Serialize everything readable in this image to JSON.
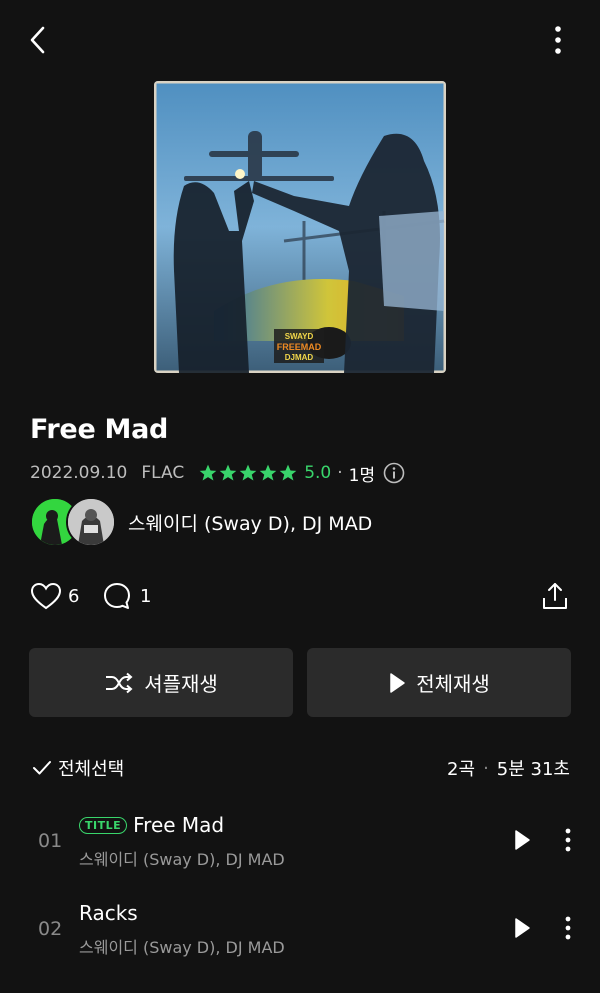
{
  "album": {
    "title": "Free Mad",
    "release_date": "2022.09.10",
    "format": "FLAC",
    "rating": "5.0",
    "rating_count": "1명",
    "artists": "스웨이디 (Sway D), DJ MAD",
    "cover_text": [
      "SWAYD",
      "FREEMAD",
      "DJMAD"
    ]
  },
  "social": {
    "likes": "6",
    "comments": "1"
  },
  "actions": {
    "shuffle_label": "셔플재생",
    "play_all_label": "전체재생"
  },
  "tracklist": {
    "select_all_label": "전체선택",
    "count": "2곡",
    "duration": "5분 31초",
    "title_badge": "TITLE",
    "tracks": [
      {
        "num": "01",
        "title": "Free Mad",
        "artist": "스웨이디 (Sway D), DJ MAD",
        "is_title": true
      },
      {
        "num": "02",
        "title": "Racks",
        "artist": "스웨이디 (Sway D), DJ MAD",
        "is_title": false
      }
    ]
  },
  "colors": {
    "accent": "#39d56b",
    "background": "#121212",
    "button": "#2b2b2b"
  }
}
